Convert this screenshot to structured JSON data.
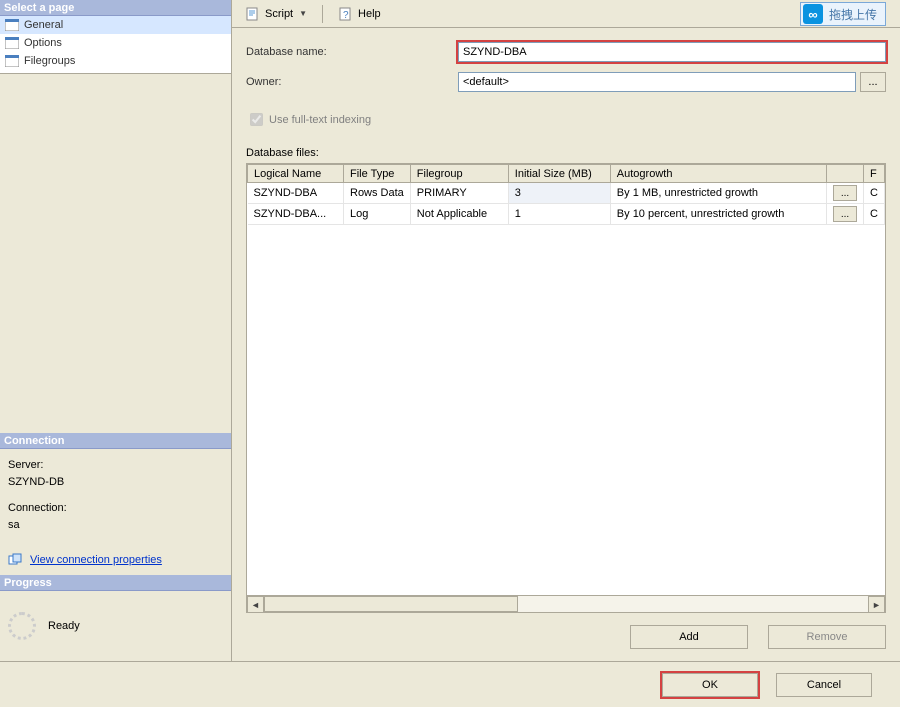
{
  "sidebar": {
    "select_page_header": "Select a page",
    "pages": [
      {
        "label": "General",
        "selected": true
      },
      {
        "label": "Options",
        "selected": false
      },
      {
        "label": "Filegroups",
        "selected": false
      }
    ],
    "connection_header": "Connection",
    "server_label": "Server:",
    "server_value": "SZYND-DB",
    "connection_label": "Connection:",
    "connection_value": "sa",
    "view_conn_properties": "View connection properties",
    "progress_header": "Progress",
    "progress_status": "Ready"
  },
  "toolbar": {
    "script_label": "Script",
    "help_label": "Help"
  },
  "upload": {
    "label": "拖拽上传"
  },
  "form": {
    "db_name_label": "Database name:",
    "db_name_value": "SZYND-DBA",
    "owner_label": "Owner:",
    "owner_value": "<default>",
    "owner_ellipsis": "...",
    "fulltext_label": "Use full-text indexing",
    "db_files_label": "Database files:"
  },
  "table": {
    "headers": {
      "logical_name": "Logical Name",
      "file_type": "File Type",
      "filegroup": "Filegroup",
      "initial_size": "Initial Size (MB)",
      "autogrowth": "Autogrowth",
      "path_col": "F"
    },
    "rows": [
      {
        "logical_name": "SZYND-DBA",
        "file_type": "Rows Data",
        "filegroup": "PRIMARY",
        "initial_size": "3",
        "autogrowth": "By 1 MB, unrestricted growth",
        "autogrowth_btn": "...",
        "path_trunc": "C"
      },
      {
        "logical_name": "SZYND-DBA...",
        "file_type": "Log",
        "filegroup": "Not Applicable",
        "initial_size": "1",
        "autogrowth": "By 10 percent, unrestricted growth",
        "autogrowth_btn": "...",
        "path_trunc": "C"
      }
    ]
  },
  "buttons": {
    "add": "Add",
    "remove": "Remove",
    "ok": "OK",
    "cancel": "Cancel"
  }
}
